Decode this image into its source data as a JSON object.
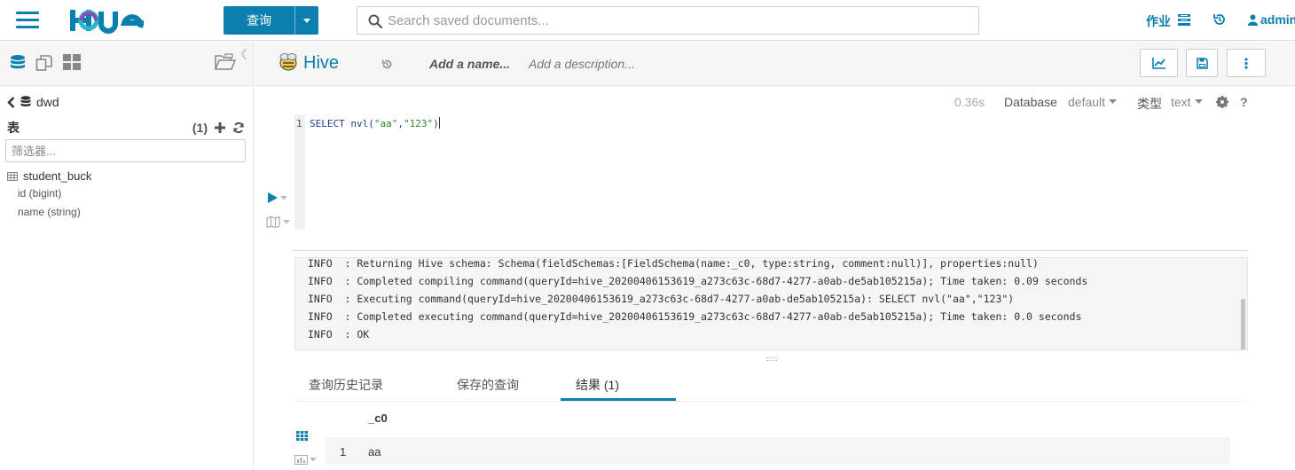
{
  "topbar": {
    "query_button": "查询",
    "search_placeholder": "Search saved documents...",
    "jobs_label": "作业",
    "user_label": "admin"
  },
  "left_panel": {
    "database": "dwd",
    "tables_label": "表",
    "tables_count": "(1)",
    "filter_placeholder": "筛选器...",
    "table": {
      "name": "student_buck",
      "columns": [
        "id (bigint)",
        "name (string)"
      ]
    }
  },
  "editor": {
    "engine_title": "Hive",
    "name_placeholder": "Add a name...",
    "description_placeholder": "Add a description...",
    "elapsed": "0.36s",
    "database_label": "Database",
    "database_value": "default",
    "type_label": "类型",
    "type_value": "text",
    "line_number": "1",
    "code_prefix": "SELECT nvl(",
    "code_str1": "\"aa\"",
    "code_comma": ",",
    "code_str2": "\"123\"",
    "code_suffix": ")"
  },
  "log": {
    "lines": [
      "INFO  : Returning Hive schema: Schema(fieldSchemas:[FieldSchema(name:_c0, type:string, comment:null)], properties:null)",
      "INFO  : Completed compiling command(queryId=hive_20200406153619_a273c63c-68d7-4277-a0ab-de5ab105215a); Time taken: 0.09 seconds",
      "INFO  : Executing command(queryId=hive_20200406153619_a273c63c-68d7-4277-a0ab-de5ab105215a): SELECT nvl(\"aa\",\"123\")",
      "INFO  : Completed executing command(queryId=hive_20200406153619_a273c63c-68d7-4277-a0ab-de5ab105215a); Time taken: 0.0 seconds",
      "INFO  : OK"
    ]
  },
  "tabs": {
    "history": "查询历史记录",
    "saved": "保存的查询",
    "results": "结果 (1)"
  },
  "results": {
    "column": "_c0",
    "rows": [
      {
        "index": "1",
        "value": "aa"
      }
    ]
  },
  "colors": {
    "accent": "#0B7FAD",
    "string": "#2a8a2a",
    "keyword": "#1f3b8c"
  }
}
